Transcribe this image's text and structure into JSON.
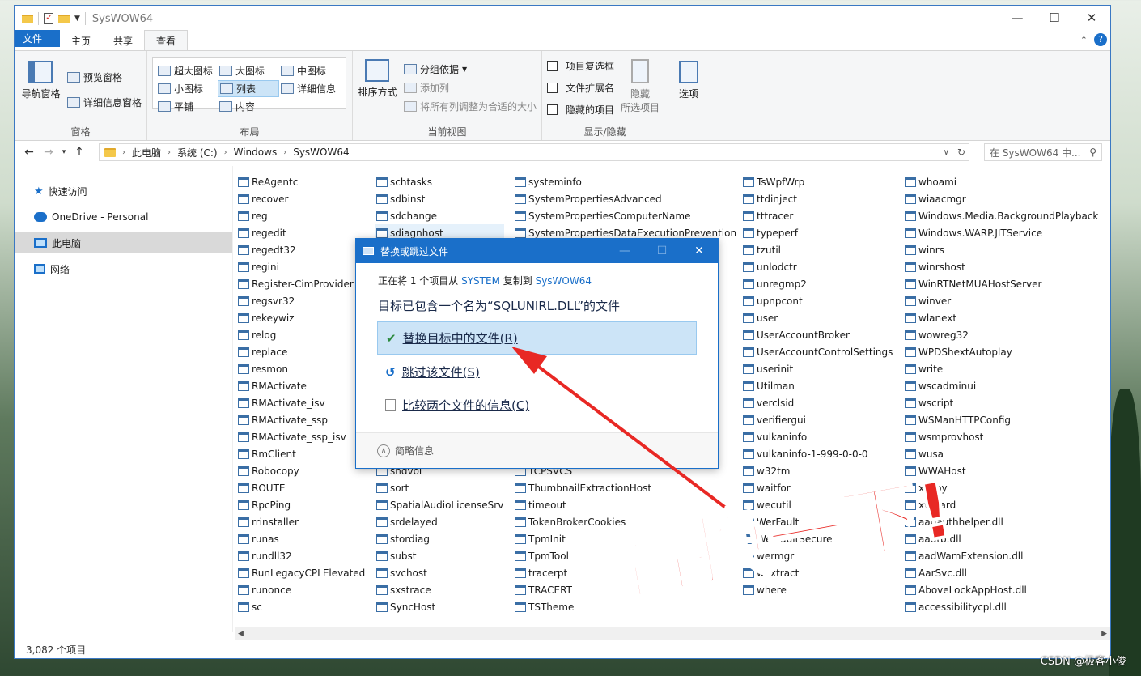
{
  "window": {
    "title": "SysWOW64",
    "controls": [
      "—",
      "☐",
      "✕"
    ]
  },
  "ribbon_tabs": [
    "文件",
    "主页",
    "共享",
    "查看"
  ],
  "ribbon": {
    "panes": {
      "nav_pane": "导航窗格",
      "preview_pane": "预览窗格",
      "details_pane": "详细信息窗格",
      "label": "窗格"
    },
    "layout": {
      "items": [
        "超大图标",
        "大图标",
        "中图标",
        "小图标",
        "列表",
        "详细信息",
        "平铺",
        "内容"
      ],
      "label": "布局"
    },
    "current_view": {
      "sort": "排序方式",
      "group_by": "分组依据",
      "add_column": "添加列",
      "fit_columns": "将所有列调整为合适的大小",
      "label": "当前视图"
    },
    "show_hide": {
      "item_checkboxes": "项目复选框",
      "file_ext": "文件扩展名",
      "hidden_items": "隐藏的项目",
      "hide_selected_1": "隐藏",
      "hide_selected_2": "所选项目",
      "label": "显示/隐藏"
    },
    "options": "选项"
  },
  "address": {
    "crumbs": [
      "此电脑",
      "系统 (C:)",
      "Windows",
      "SysWOW64"
    ],
    "search_placeholder": "在 SysWOW64 中..."
  },
  "sidebar": {
    "items": [
      {
        "label": "快速访问",
        "icon": "star-icon"
      },
      {
        "label": "OneDrive - Personal",
        "icon": "cloud-icon"
      },
      {
        "label": "此电脑",
        "icon": "computer-icon"
      },
      {
        "label": "网络",
        "icon": "network-icon"
      }
    ]
  },
  "files": {
    "col1": [
      "ReAgentc",
      "recover",
      "reg",
      "regedit",
      "regedt32",
      "regini",
      "Register-CimProvider",
      "regsvr32",
      "rekeywiz",
      "relog",
      "replace",
      "resmon",
      "RMActivate",
      "RMActivate_isv",
      "RMActivate_ssp",
      "RMActivate_ssp_isv",
      "RmClient",
      "Robocopy",
      "ROUTE",
      "RpcPing",
      "rrinstaller",
      "runas",
      "rundll32",
      "RunLegacyCPLElevated",
      "runonce",
      "sc"
    ],
    "col2": [
      "schtasks",
      "sdbinst",
      "sdchange",
      "sdiagnhost",
      "",
      "",
      "",
      "",
      "",
      "",
      "",
      "",
      "",
      "",
      "",
      "",
      "",
      "shdvol",
      "sort",
      "SpatialAudioLicenseSrv",
      "srdelayed",
      "stordiag",
      "subst",
      "svchost",
      "sxstrace",
      "SyncHost"
    ],
    "col3": [
      "systeminfo",
      "SystemPropertiesAdvanced",
      "SystemPropertiesComputerName",
      "SystemPropertiesDataExecutionPrevention",
      "",
      "",
      "",
      "",
      "",
      "",
      "",
      "",
      "",
      "",
      "",
      "",
      "",
      "TCPSVCS",
      "ThumbnailExtractionHost",
      "timeout",
      "TokenBrokerCookies",
      "TpmInit",
      "TpmTool",
      "tracerpt",
      "TRACERT",
      "TSTheme"
    ],
    "col4": [
      "TsWpfWrp",
      "ttdinject",
      "tttracer",
      "typeperf",
      "tzutil",
      "unlodctr",
      "unregmp2",
      "upnpcont",
      "user",
      "UserAccountBroker",
      "UserAccountControlSettings",
      "userinit",
      "Utilman",
      "verclsid",
      "verifiergui",
      "vulkaninfo",
      "vulkaninfo-1-999-0-0-0",
      "w32tm",
      "waitfor",
      "wecutil",
      "WerFault",
      "WerFaultSecure",
      "wermgr",
      "wextract",
      "where",
      ""
    ],
    "col5": [
      "whoami",
      "wiaacmgr",
      "Windows.Media.BackgroundPlayback",
      "Windows.WARP.JITService",
      "winrs",
      "winrshost",
      "WinRTNetMUAHostServer",
      "winver",
      "wlanext",
      "wowreg32",
      "WPDShextAutoplay",
      "write",
      "wscadminui",
      "wscript",
      "WSManHTTPConfig",
      "wsmprovhost",
      "wusa",
      "WWAHost",
      "xcopy",
      "xwizard",
      "aadauthhelper.dll",
      "aadtb.dll",
      "aadWamExtension.dll",
      "AarSvc.dll",
      "AboveLockAppHost.dll",
      "accessibilitycpl.dll"
    ]
  },
  "status": {
    "count": "3,082 个项目"
  },
  "dialog": {
    "title": "替换或跳过文件",
    "line_prefix": "正在将 1 个项目从 ",
    "source": "SYSTEM",
    "line_mid": " 复制到 ",
    "dest": "SysWOW64",
    "heading": "目标已包含一个名为“SQLUNIRL.DLL”的文件",
    "opt_replace": "替换目标中的文件(R)",
    "opt_skip": "跳过该文件(S)",
    "opt_compare": "比较两个文件的信息(C)",
    "footer": "简略信息"
  },
  "annotation": {
    "text": "替换一下!",
    "color": "#e82824"
  },
  "watermark": "CSDN @极客小俊"
}
